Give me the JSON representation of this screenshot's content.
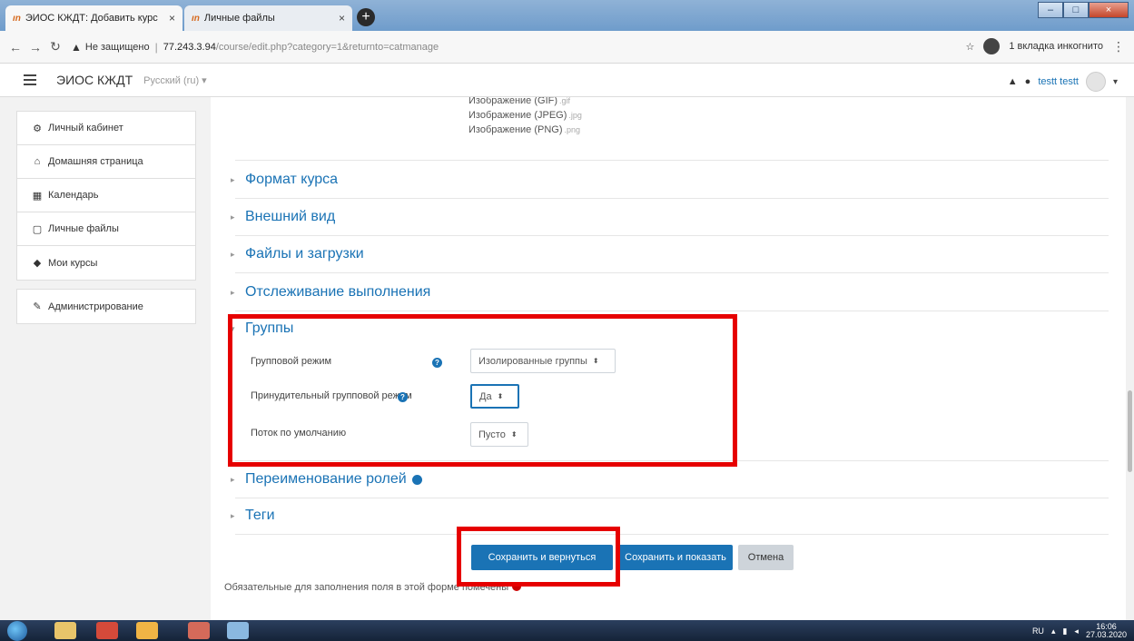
{
  "browser": {
    "tabs": [
      {
        "favicon": "ın",
        "title": "ЭИОС КЖДТ: Добавить курс",
        "close": "×"
      },
      {
        "favicon": "ın",
        "title": "Личные файлы",
        "close": "×"
      }
    ],
    "new_tab": "+",
    "insecure_label": "Не защищено",
    "url_host": "77.243.3.94",
    "url_path": "/course/edit.php?category=1&returnto=catmanage",
    "incognito_label": "1 вкладка инкогнито"
  },
  "navbar": {
    "site_name": "ЭИОС КЖДТ",
    "language": "Русский (ru) ▾",
    "user_name": "testt testt"
  },
  "drawer": {
    "items": [
      {
        "icon": "dashboard-icon",
        "glyph": "⚙",
        "label": "Личный кабинет"
      },
      {
        "icon": "home-icon",
        "glyph": "⌂",
        "label": "Домашняя страница"
      },
      {
        "icon": "calendar-icon",
        "glyph": "▦",
        "label": "Календарь"
      },
      {
        "icon": "file-icon",
        "glyph": "▢",
        "label": "Личные файлы"
      },
      {
        "icon": "graduation-cap-icon",
        "glyph": "◆",
        "label": "Мои курсы"
      }
    ],
    "admin": {
      "icon": "wrench-icon",
      "glyph": "✎",
      "label": "Администрирование"
    }
  },
  "form": {
    "filetypes": [
      {
        "label": "Изображение (GIF)",
        "ext": ".gif"
      },
      {
        "label": "Изображение (JPEG)",
        "ext": ".jpg"
      },
      {
        "label": "Изображение (PNG)",
        "ext": ".png"
      }
    ],
    "sections": {
      "course_format": "Формат курса",
      "appearance": "Внешний вид",
      "files": "Файлы и загрузки",
      "completion": "Отслеживание выполнения",
      "groups": "Группы",
      "roles": "Переименование ролей",
      "tags": "Теги"
    },
    "groups": {
      "group_mode_label": "Групповой режим",
      "group_mode_value": "Изолированные группы",
      "force_label": "Принудительный групповой режим",
      "force_value": "Да",
      "grouping_label": "Поток по умолчанию",
      "grouping_value": "Пусто"
    },
    "buttons": {
      "save_return": "Сохранить и вернуться",
      "save_display": "Сохранить и показать",
      "cancel": "Отмена"
    },
    "required_note": "Обязательные для заполнения поля в этой форме помечены"
  },
  "taskbar": {
    "lang": "RU",
    "time": "16:06",
    "date": "27.03.2020"
  },
  "colors": {
    "moodle_blue": "#1a73b5",
    "highlight_red": "#e60000"
  }
}
